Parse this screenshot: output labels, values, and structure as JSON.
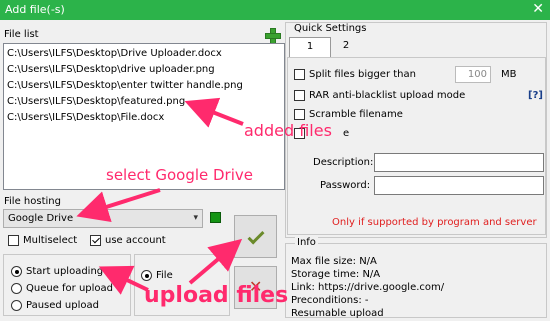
{
  "window": {
    "title": "Add file(-s)",
    "close_glyph": "✕"
  },
  "file_list": {
    "label": "File list",
    "items": [
      "C:\\Users\\ILFS\\Desktop\\Drive Uploader.docx",
      "C:\\Users\\ILFS\\Desktop\\drive uploader.png",
      "C:\\Users\\ILFS\\Desktop\\enter twitter handle.png",
      "C:\\Users\\ILFS\\Desktop\\featured.png",
      "C:\\Users\\ILFS\\Desktop\\File.docx"
    ],
    "add_icon": "plus-icon"
  },
  "file_hosting": {
    "label": "File hosting",
    "selected": "Google Drive",
    "multiselect_label": "Multiselect",
    "multiselect_checked": false,
    "use_account_label": "use account",
    "use_account_checked": true
  },
  "upload_options": {
    "radios": [
      {
        "label": "Start uploading",
        "selected": true
      },
      {
        "label": "Queue for upload",
        "selected": false
      },
      {
        "label": "Paused upload",
        "selected": false
      }
    ],
    "second_radio_label": "File"
  },
  "quick_settings": {
    "label": "Quick Settings",
    "tabs": [
      "1",
      "2"
    ],
    "split_label": "Split files bigger than",
    "split_value": "100",
    "split_unit": "MB",
    "rar_label": "RAR anti-blacklist upload mode",
    "help_label": "[?]",
    "scramble_label": "Scramble filename",
    "extra_label": "e",
    "description_label": "Description:",
    "password_label": "Password:",
    "note": "Only if supported by program and server"
  },
  "info": {
    "label": "Info",
    "lines": [
      "Max file size: N/A",
      "Storage time: N/A",
      "Link: https://drive.google.com/",
      "Preconditions: -",
      "Resumable upload"
    ]
  },
  "annotations": {
    "added_files": "added files",
    "select_drive": "select Google Drive",
    "upload_files": "upload files"
  },
  "colors": {
    "title_bar": "#2cb34a",
    "annotation": "#ff2a6d",
    "note": "#e02020"
  }
}
